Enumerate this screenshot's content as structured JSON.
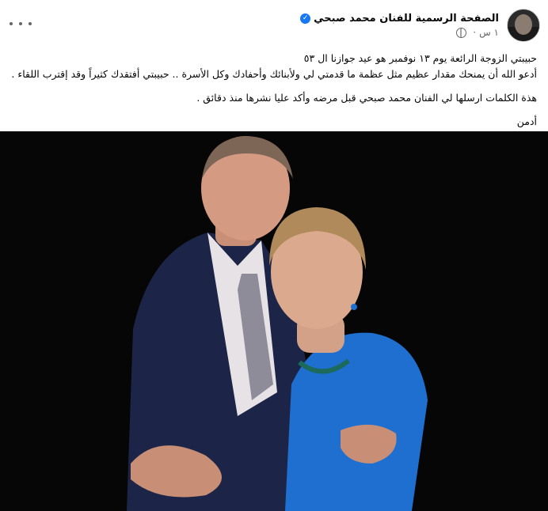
{
  "post": {
    "page_name": "الصفحة الرسمية للفنان محمد صبحي",
    "time": "١ س",
    "separator": "·",
    "lines": [
      "حبيبتي الزوجة الرائعة يوم ١٣ نوفمبر هو عيد جوازنا ال ٥٣",
      "أدعو الله أن يمنحك مقدار عظيم مثل عظمة ما قدمتي لي ولأبنائك وأحفادك وكل الأسرة .. حبيبتي أفتقدك كثيراً وقد إقترب اللقاء .",
      "هذة الكلمات ارسلها لي الفنان محمد صبحي قبل مرضه وأكد عليا نشرها منذ دقائق .",
      "أدمن"
    ]
  },
  "icons": {
    "verified": "verified-badge-icon",
    "audience": "globe-icon",
    "more": "more-dots-icon"
  },
  "colors": {
    "verified": "#1877f2",
    "meta_text": "#65676b",
    "photo_background": "#060606",
    "dress": "#1e6fd0",
    "suit": "#1c2547"
  }
}
